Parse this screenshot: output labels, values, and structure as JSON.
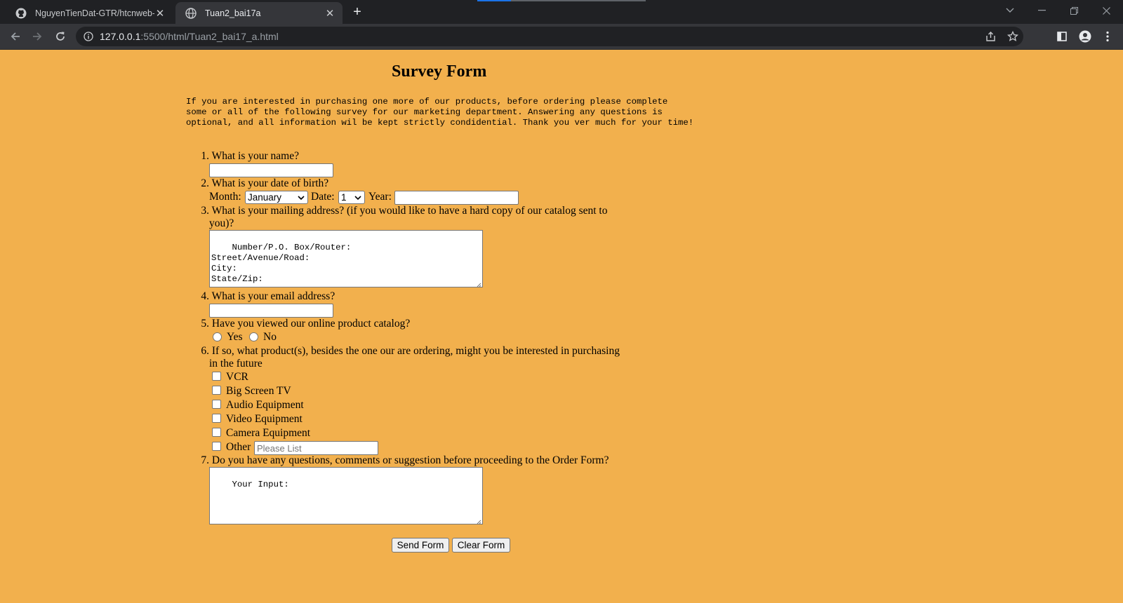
{
  "browser": {
    "tabs": [
      {
        "title": "NguyenTienDat-GTR/htcnweb-b",
        "icon": "github-icon",
        "active": false
      },
      {
        "title": "Tuan2_bai17a",
        "icon": "globe-icon",
        "active": true
      }
    ],
    "url_host": "127.0.0.1",
    "url_rest": ":5500/html/Tuan2_bai17_a.html"
  },
  "form": {
    "title": "Survey Form",
    "intro": "If you are interested in purchasing one more of our products, before ordering please complete\nsome or all of the following survey for our marketing department. Answering any questions is\noptional, and all information wil be kept strictly condidential. Thank you ver much for your time!",
    "q1": {
      "num": "1.",
      "text": "What is your name?"
    },
    "q2": {
      "num": "2.",
      "text": "What is your date of birth?",
      "month_label": "Month:",
      "month_value": "January",
      "date_label": "Date:",
      "date_value": "1",
      "year_label": "Year:"
    },
    "q3": {
      "num": "3.",
      "text_line1": "What is your mailing address? (if you would like to have a hard copy of our catalog sent to",
      "text_line2": "you)?",
      "textarea": "Number/P.O. Box/Router:\nStreet/Avenue/Road:\nCity:\nState/Zip:"
    },
    "q4": {
      "num": "4.",
      "text": "What is your email address?"
    },
    "q5": {
      "num": "5.",
      "text": "Have you viewed our online product catalog?",
      "yes": "Yes",
      "no": "No"
    },
    "q6": {
      "num": "6.",
      "text_line1": "If so, what product(s), besides the one our are ordering, might you be interested in purchasing",
      "text_line2": "in the future",
      "options": [
        "VCR",
        "Big Screen TV",
        "Audio Equipment",
        "Video Equipment",
        "Camera Equipment",
        "Other"
      ],
      "other_placeholder": "Please List"
    },
    "q7": {
      "num": "7.",
      "text": "Do you have any questions, comments or suggestion before proceeding to the Order Form?",
      "textarea": "Your Input:"
    },
    "send_label": "Send Form",
    "clear_label": "Clear Form"
  },
  "colors": {
    "page_bg": "#f2b04d",
    "chrome_dark": "#202124",
    "chrome_mid": "#35363a"
  }
}
